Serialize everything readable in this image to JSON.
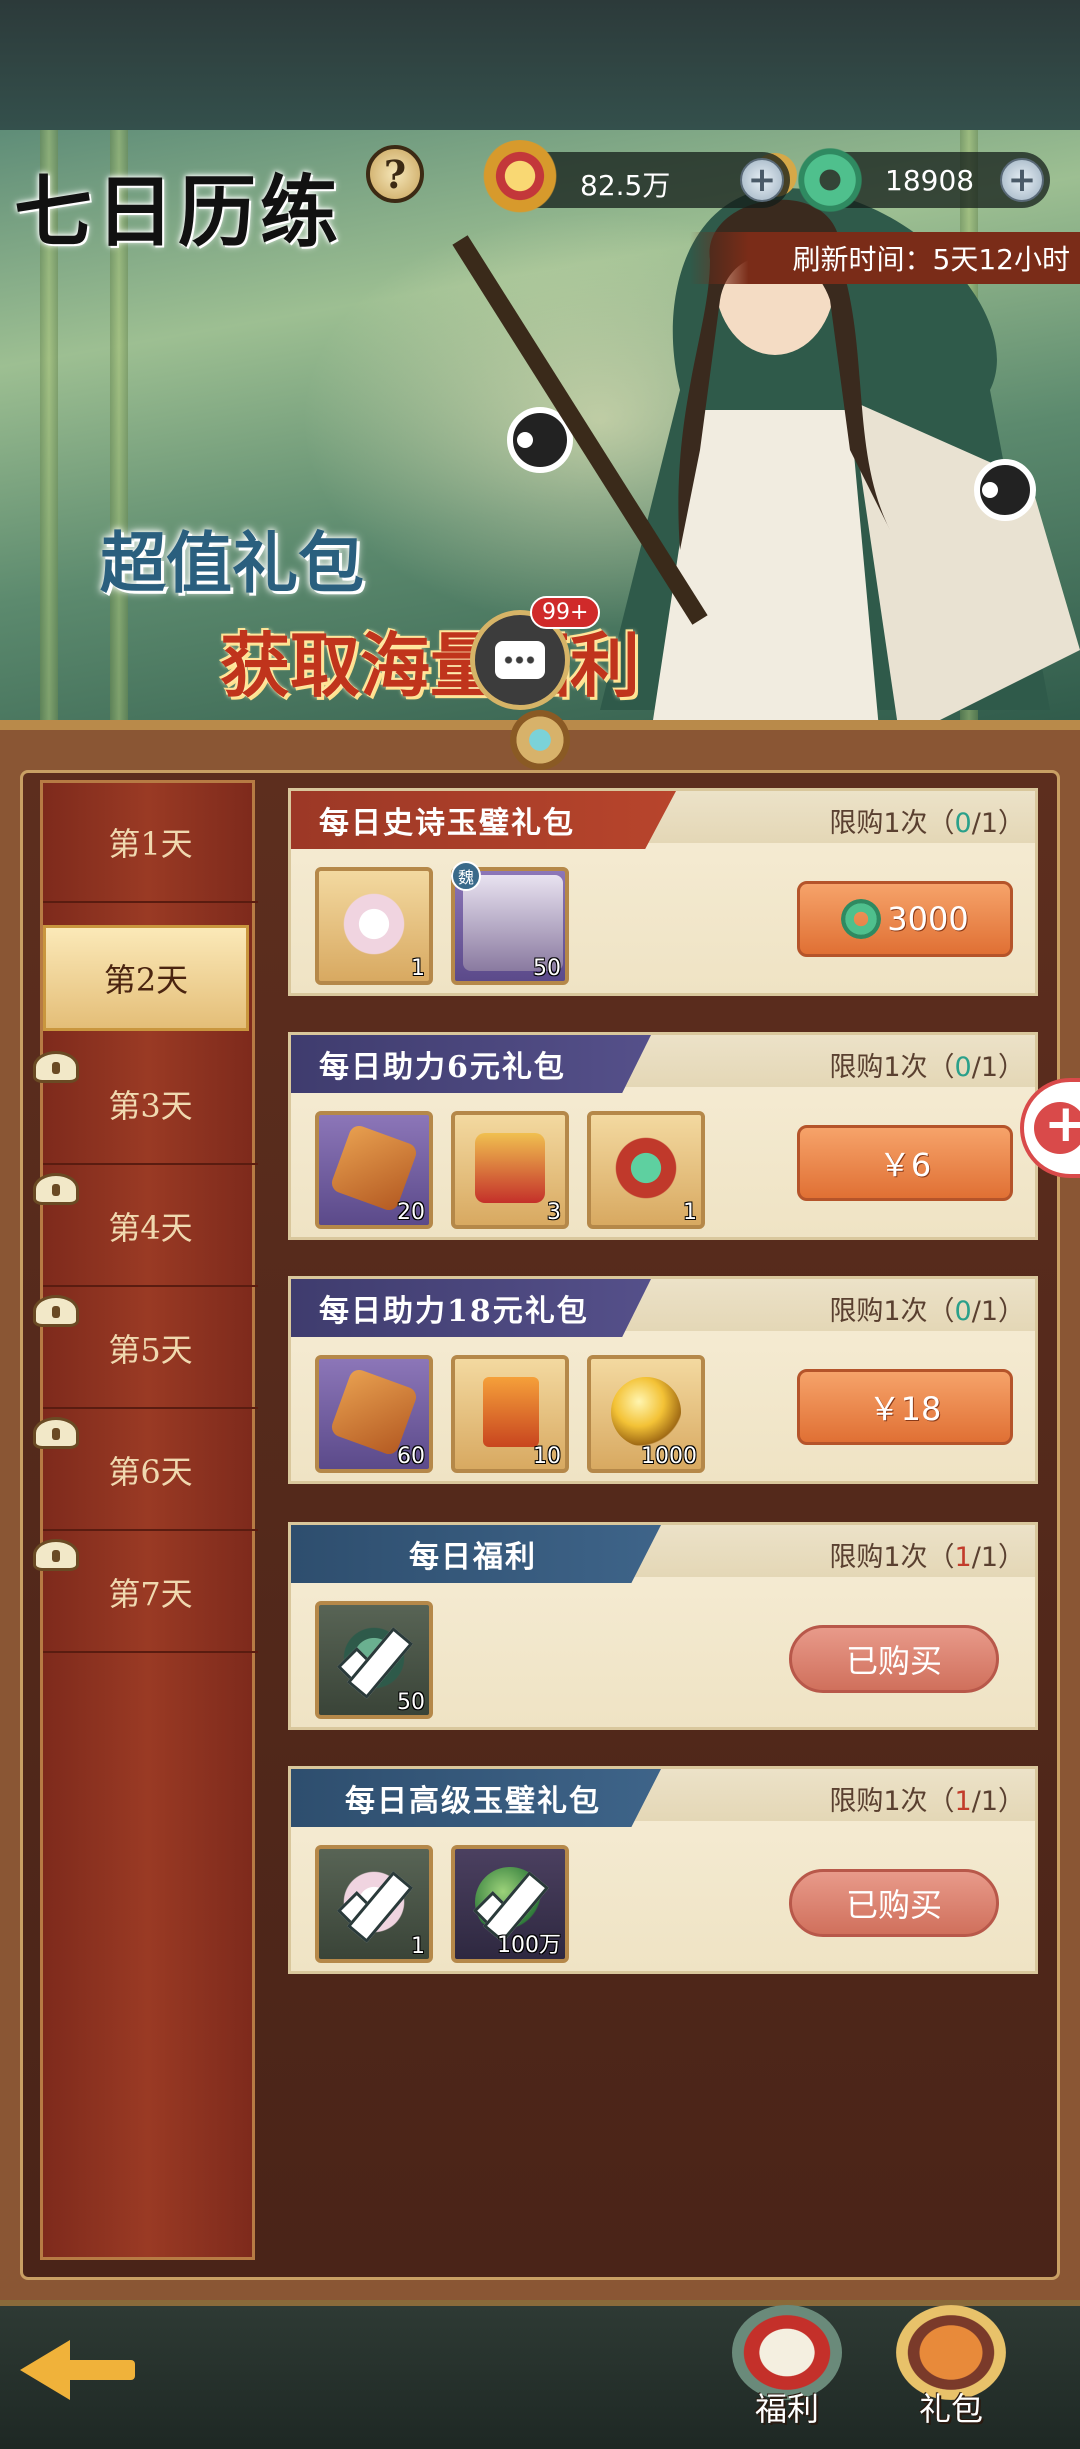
{
  "header": {
    "title": "七日历练",
    "gold_amount": "82.5万",
    "jade_amount": "18908",
    "refresh_text": "刷新时间：5天12小时"
  },
  "banner": {
    "promo_line1": "超值礼包",
    "promo_line2": "获取海量福利",
    "chat_badge": "99+"
  },
  "days": [
    {
      "label": "第1天",
      "locked": false,
      "active": false
    },
    {
      "label": "第2天",
      "locked": false,
      "active": true
    },
    {
      "label": "第3天",
      "locked": true,
      "active": false
    },
    {
      "label": "第4天",
      "locked": true,
      "active": false
    },
    {
      "label": "第5天",
      "locked": true,
      "active": false
    },
    {
      "label": "第6天",
      "locked": true,
      "active": false
    },
    {
      "label": "第7天",
      "locked": true,
      "active": false
    }
  ],
  "packages": [
    {
      "title": "每日史诗玉璧礼包",
      "limit_prefix": "限购1次（",
      "limit_count": "0",
      "limit_suffix": "/1）",
      "items": [
        {
          "icon": "lotus-icon",
          "qty": "1"
        },
        {
          "icon": "hero-portrait-icon",
          "qty": "50",
          "tag": "魏"
        }
      ],
      "button": "3000",
      "status": "available"
    },
    {
      "title": "每日助力6元礼包",
      "limit_prefix": "限购1次（",
      "limit_count": "0",
      "limit_suffix": "/1）",
      "items": [
        {
          "icon": "token-icon",
          "qty": "20"
        },
        {
          "icon": "red-scroll-icon",
          "qty": "3"
        },
        {
          "icon": "jade-bag-icon",
          "qty": "1"
        }
      ],
      "button": "￥6",
      "status": "available"
    },
    {
      "title": "每日助力18元礼包",
      "limit_prefix": "限购1次（",
      "limit_count": "0",
      "limit_suffix": "/1）",
      "items": [
        {
          "icon": "token-icon",
          "qty": "60"
        },
        {
          "icon": "order-scroll-icon",
          "qty": "10"
        },
        {
          "icon": "golden-orb-icon",
          "qty": "1000"
        }
      ],
      "button": "￥18",
      "status": "available"
    },
    {
      "title": "每日福利",
      "limit_prefix": "限购1次（",
      "limit_count": "1",
      "limit_suffix": "/1）",
      "items": [
        {
          "icon": "jade-icon",
          "qty": "50"
        }
      ],
      "button": "已购买",
      "status": "bought"
    },
    {
      "title": "每日高级玉璧礼包",
      "limit_prefix": "限购1次（",
      "limit_count": "1",
      "limit_suffix": "/1）",
      "items": [
        {
          "icon": "lotus-icon",
          "qty": "1"
        },
        {
          "icon": "green-orb-icon",
          "qty": "100万"
        }
      ],
      "button": "已购买",
      "status": "bought"
    }
  ],
  "nav": {
    "welfare": "福利",
    "gift": "礼包"
  }
}
